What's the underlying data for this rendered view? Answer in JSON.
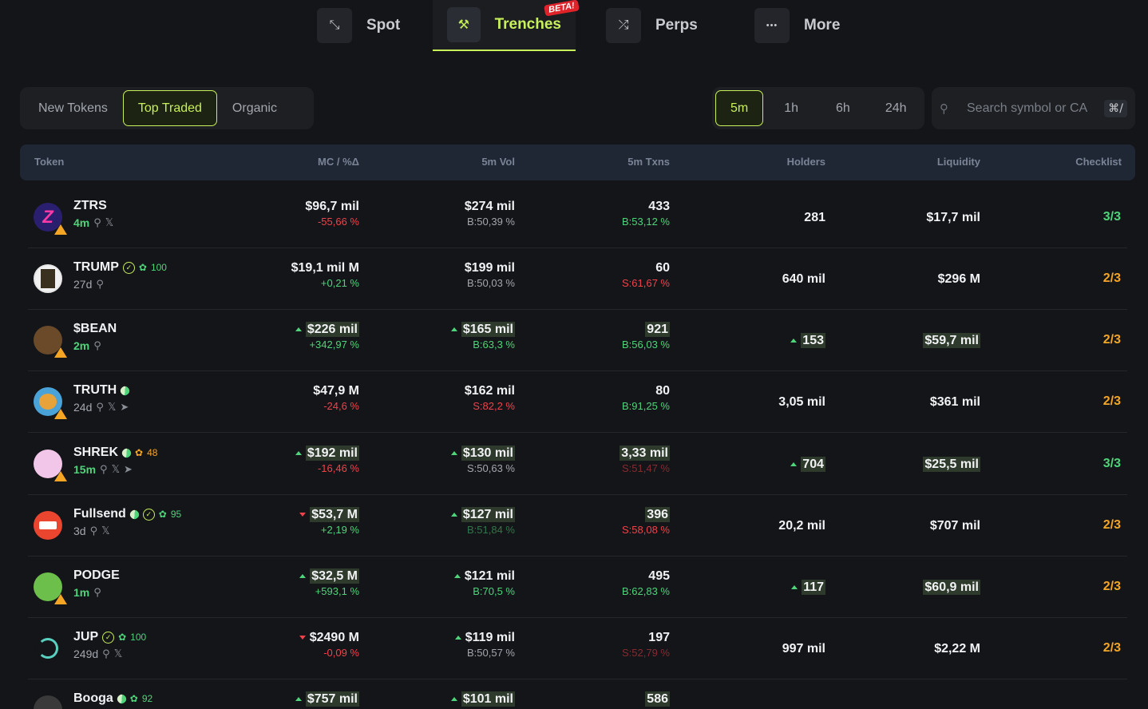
{
  "nav": [
    {
      "label": "Spot",
      "icon": "swap-icon",
      "glyph": "⤡"
    },
    {
      "label": "Trenches",
      "icon": "shovel-icon",
      "glyph": "⚒",
      "badge": "BETA!"
    },
    {
      "label": "Perps",
      "icon": "arrows-icon",
      "glyph": "⤮"
    },
    {
      "label": "More",
      "icon": "more-icon",
      "glyph": "•••"
    }
  ],
  "filters": {
    "categories": [
      "New Tokens",
      "Top Traded",
      "Organic"
    ],
    "active_category": "Top Traded",
    "timeframes": [
      "5m",
      "1h",
      "6h",
      "24h"
    ],
    "active_timeframe": "5m"
  },
  "search": {
    "placeholder": "Search symbol or CA",
    "shortcut": "⌘/"
  },
  "columns": [
    "Token",
    "MC / %Δ",
    "5m Vol",
    "5m Txns",
    "Holders",
    "Liquidity",
    "Checklist"
  ],
  "colors": {
    "accent": "#c8f05a",
    "positive": "#4ed47a",
    "negative": "#f0424a",
    "warning": "#f5a524"
  },
  "rows": [
    {
      "name": "ZTRS",
      "age": "4m",
      "mc": "$96,7 mil",
      "mc_change": "-55,66 %",
      "vol": "$274 mil",
      "vol_sub": "B:50,39 %",
      "txns": "433",
      "txns_sub": "B:53,12 %",
      "holders": "281",
      "liquidity": "$17,7 mil",
      "checklist": "3/3"
    },
    {
      "name": "TRUMP",
      "age": "27d",
      "score": "100",
      "mc": "$19,1 mil M",
      "mc_change": "+0,21 %",
      "vol": "$199 mil",
      "vol_sub": "B:50,03 %",
      "txns": "60",
      "txns_sub": "S:61,67 %",
      "holders": "640 mil",
      "liquidity": "$296 M",
      "checklist": "2/3"
    },
    {
      "name": "$BEAN",
      "age": "2m",
      "mc": "$226 mil",
      "mc_change": "+342,97 %",
      "vol": "$165 mil",
      "vol_sub": "B:63,3 %",
      "txns": "921",
      "txns_sub": "B:56,03 %",
      "holders": "153",
      "liquidity": "$59,7 mil",
      "checklist": "2/3"
    },
    {
      "name": "TRUTH",
      "age": "24d",
      "mc": "$47,9 M",
      "mc_change": "-24,6 %",
      "vol": "$162 mil",
      "vol_sub": "S:82,2 %",
      "txns": "80",
      "txns_sub": "B:91,25 %",
      "holders": "3,05 mil",
      "liquidity": "$361 mil",
      "checklist": "2/3"
    },
    {
      "name": "SHREK",
      "age": "15m",
      "score": "48",
      "mc": "$192 mil",
      "mc_change": "-16,46 %",
      "vol": "$130 mil",
      "vol_sub": "S:50,63 %",
      "txns": "3,33 mil",
      "txns_sub": "S:51,47 %",
      "holders": "704",
      "liquidity": "$25,5 mil",
      "checklist": "3/3"
    },
    {
      "name": "Fullsend",
      "age": "3d",
      "score": "95",
      "mc": "$53,7 M",
      "mc_change": "+2,19 %",
      "vol": "$127 mil",
      "vol_sub": "B:51,84 %",
      "txns": "396",
      "txns_sub": "S:58,08 %",
      "holders": "20,2 mil",
      "liquidity": "$707 mil",
      "checklist": "2/3"
    },
    {
      "name": "PODGE",
      "age": "1m",
      "mc": "$32,5 M",
      "mc_change": "+593,1 %",
      "vol": "$121 mil",
      "vol_sub": "B:70,5 %",
      "txns": "495",
      "txns_sub": "B:62,83 %",
      "holders": "117",
      "liquidity": "$60,9 mil",
      "checklist": "2/3"
    },
    {
      "name": "JUP",
      "age": "249d",
      "score": "100",
      "mc": "$2490 M",
      "mc_change": "-0,09 %",
      "vol": "$119 mil",
      "vol_sub": "B:50,57 %",
      "txns": "197",
      "txns_sub": "S:52,79 %",
      "holders": "997 mil",
      "liquidity": "$2,22 M",
      "checklist": "2/3"
    },
    {
      "name": "Booga",
      "score": "92",
      "mc": "$757 mil",
      "vol": "$101 mil",
      "txns": "586"
    }
  ]
}
